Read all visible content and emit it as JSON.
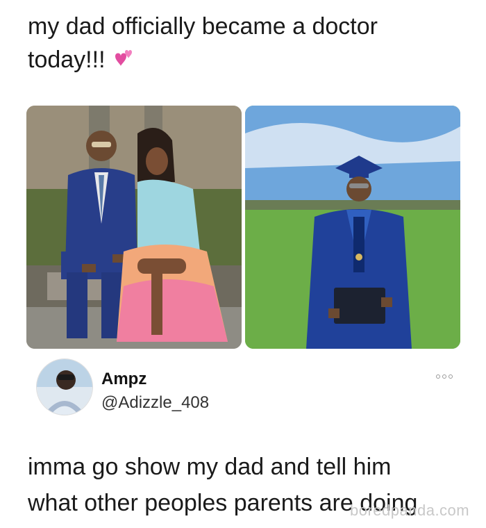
{
  "post": {
    "top_caption_line1": "my dad officially became a doctor",
    "top_caption_line2": "today!!!",
    "emoji": "💕"
  },
  "reply": {
    "display_name": "Ampz",
    "handle": "@Adizzle_408",
    "text_line1": "imma go show my dad and tell him",
    "text_line2": "what other peoples parents are doing"
  },
  "watermark": {
    "text": "boredpanda.com"
  },
  "colors": {
    "text": "#1a1a1a",
    "watermark": "#c8c8c8"
  },
  "icons": [
    "two-hearts-icon",
    "more-options-icon"
  ]
}
